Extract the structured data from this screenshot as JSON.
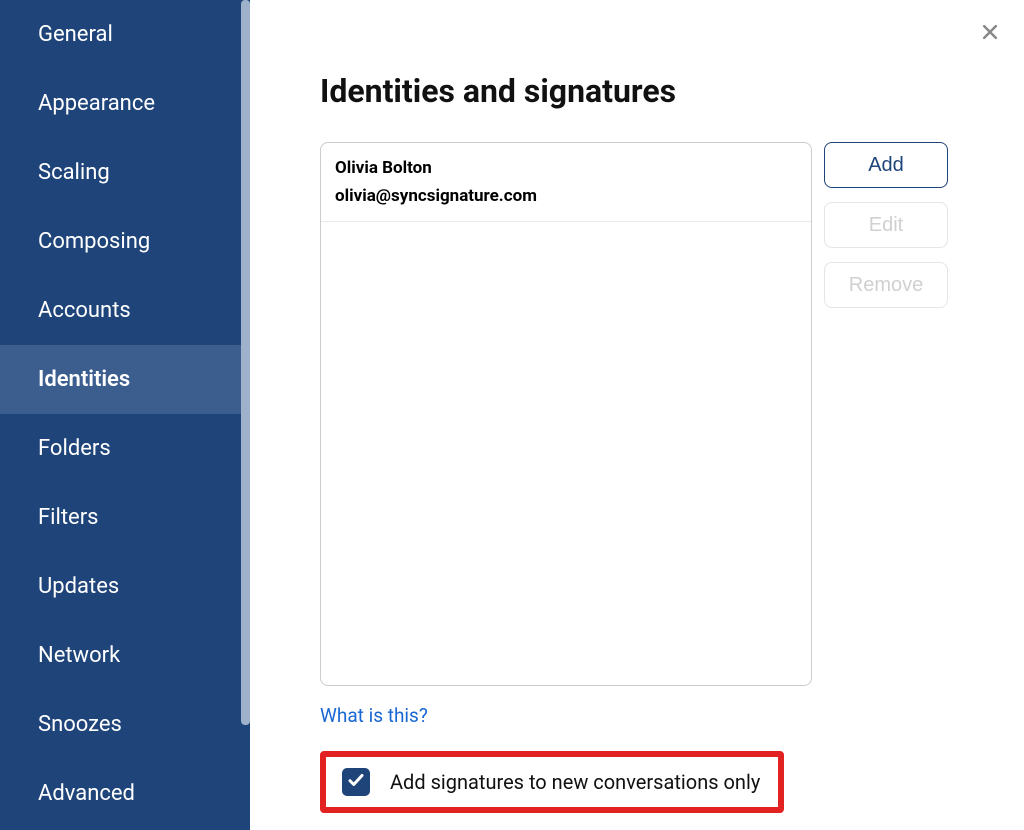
{
  "sidebar": {
    "items": [
      {
        "label": "General",
        "id": "general"
      },
      {
        "label": "Appearance",
        "id": "appearance"
      },
      {
        "label": "Scaling",
        "id": "scaling"
      },
      {
        "label": "Composing",
        "id": "composing"
      },
      {
        "label": "Accounts",
        "id": "accounts"
      },
      {
        "label": "Identities",
        "id": "identities",
        "active": true
      },
      {
        "label": "Folders",
        "id": "folders"
      },
      {
        "label": "Filters",
        "id": "filters"
      },
      {
        "label": "Updates",
        "id": "updates"
      },
      {
        "label": "Network",
        "id": "network"
      },
      {
        "label": "Snoozes",
        "id": "snoozes"
      },
      {
        "label": "Advanced",
        "id": "advanced"
      }
    ]
  },
  "main": {
    "title": "Identities and signatures",
    "identities": [
      {
        "name": "Olivia Bolton",
        "email": "olivia@syncsignature.com"
      }
    ],
    "buttons": {
      "add": "Add",
      "edit": "Edit",
      "remove": "Remove"
    },
    "help_link_text": "What is this?",
    "checkbox_label": "Add signatures to new conversations only",
    "checkbox_checked": true
  }
}
